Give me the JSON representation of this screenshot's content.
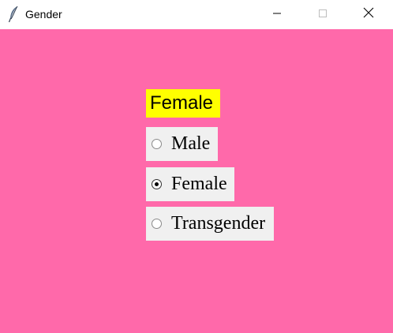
{
  "window": {
    "title": "Gender",
    "icon": "feather-icon"
  },
  "titlebar_buttons": [
    "minimize-icon",
    "maximize-icon",
    "close-icon"
  ],
  "colors": {
    "background": "#ff69aa",
    "label_background": "#ffff00",
    "radio_background": "#f0f0f0"
  },
  "selected_label": "Female",
  "gender_options": [
    {
      "label": "Male",
      "selected": false
    },
    {
      "label": "Female",
      "selected": true
    },
    {
      "label": "Transgender",
      "selected": false
    }
  ]
}
